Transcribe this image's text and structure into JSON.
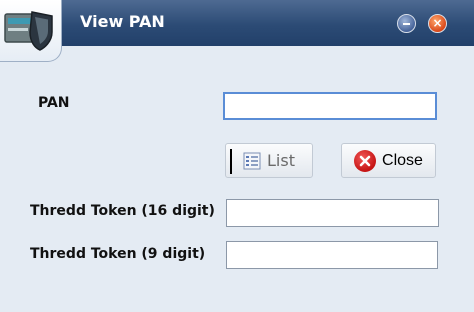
{
  "window": {
    "title": "View PAN"
  },
  "form": {
    "pan": {
      "label": "PAN",
      "value": ""
    },
    "token16": {
      "label": "Thredd Token (16 digit)",
      "value": ""
    },
    "token9": {
      "label": "Thredd Token (9 digit)",
      "value": ""
    }
  },
  "buttons": {
    "list_label": "List",
    "close_label": "Close"
  },
  "icons": {
    "app": "card-shield-icon",
    "minimize": "minimize-icon",
    "close_window": "close-icon",
    "list": "list-icon",
    "close_button": "close-circle-icon"
  },
  "colors": {
    "titlebar": "#2c4b75",
    "background": "#e4ebf3",
    "focus_border": "#5a8dd6",
    "close_red": "#d12222"
  }
}
